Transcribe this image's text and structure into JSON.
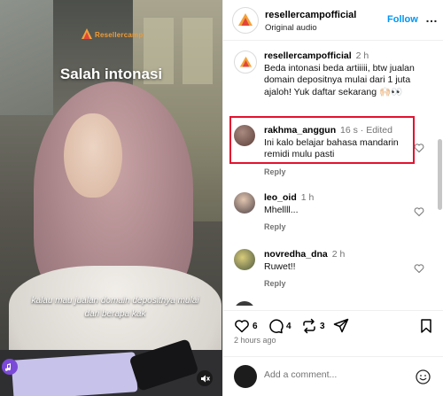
{
  "video": {
    "brand_text": "Resellercamp",
    "title_caption": "Salah intonasi",
    "sub_caption": "kalau mau jualan domain depositnya mulai dari berapa kak"
  },
  "header": {
    "username": "resellercampofficial",
    "audio": "Original audio",
    "follow_label": "Follow",
    "more_label": "…"
  },
  "comments": [
    {
      "user": "resellercampofficial",
      "time": "2 h",
      "text": "Beda intonasi beda artiiiii, btw jualan domain depositnya mulai dari 1 juta ajaloh! Yuk daftar sekarang 🙌🏻👀"
    },
    {
      "user": "rakhma_anggun",
      "time": "16 s · Edited",
      "text": "Ini kalo belajar bahasa mandarin remidi mulu pasti",
      "reply": "Reply"
    },
    {
      "user": "leo_oid",
      "time": "1 h",
      "text": "Mhellll...",
      "reply": "Reply"
    },
    {
      "user": "novredha_dna",
      "time": "2 h",
      "text": "Ruwet!!",
      "reply": "Reply"
    }
  ],
  "actions": {
    "likes": "6",
    "comments": "4",
    "reposts": "3",
    "date": "2 hours ago"
  },
  "add_comment": {
    "placeholder": "Add a comment..."
  },
  "colors": {
    "follow": "#0095f6",
    "highlight": "#e3122f",
    "brand": "#f09b34"
  }
}
